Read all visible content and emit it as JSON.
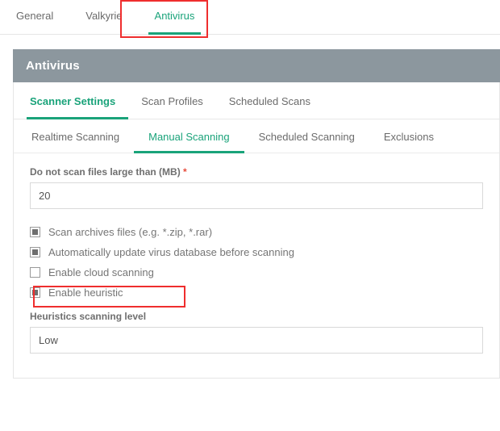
{
  "topTabs": {
    "items": [
      {
        "label": "General"
      },
      {
        "label": "Valkyrie"
      },
      {
        "label": "Antivirus"
      }
    ]
  },
  "panel": {
    "title": "Antivirus"
  },
  "sectionTabs": {
    "items": [
      {
        "label": "Scanner Settings"
      },
      {
        "label": "Scan Profiles"
      },
      {
        "label": "Scheduled Scans"
      }
    ]
  },
  "subTabs": {
    "items": [
      {
        "label": "Realtime Scanning"
      },
      {
        "label": "Manual Scanning"
      },
      {
        "label": "Scheduled Scanning"
      },
      {
        "label": "Exclusions"
      }
    ]
  },
  "form": {
    "fileSizeLabel": "Do not scan files large than (MB)",
    "fileSizeRequired": "*",
    "fileSizeValue": "20",
    "checkboxes": {
      "archives": "Scan archives files (e.g. *.zip, *.rar)",
      "autoUpdate": "Automatically update virus database before scanning",
      "cloud": "Enable cloud scanning",
      "heuristic": "Enable heuristic"
    },
    "heuristicLevelLabel": "Heuristics scanning level",
    "heuristicLevelValue": "Low"
  }
}
